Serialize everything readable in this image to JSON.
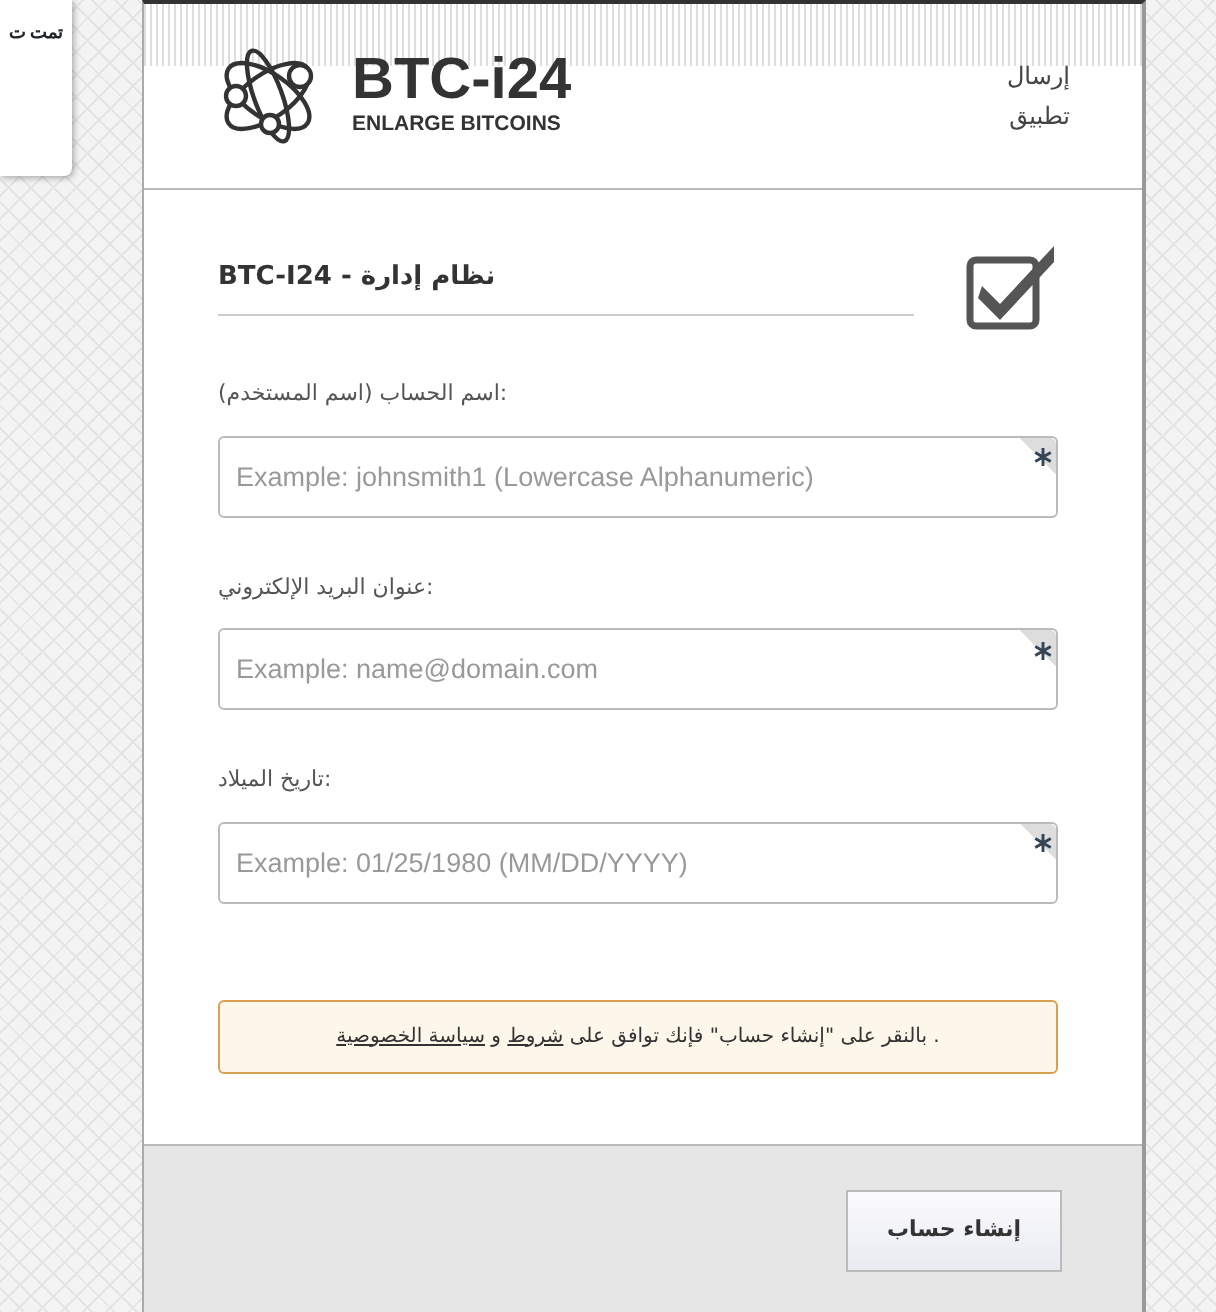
{
  "side_card": {
    "text": "تمت ت"
  },
  "header": {
    "brand": "BTC-i24",
    "tagline": "ENLARGE BITCOINS",
    "links": [
      "إرسال",
      "تطبيق"
    ]
  },
  "form": {
    "title": "BTC-I24 - نظام إدارة",
    "fields": [
      {
        "label": "اسم الحساب (اسم المستخدم):",
        "placeholder": "Example: johnsmith1 (Lowercase Alphanumeric)",
        "required": true
      },
      {
        "label": "عنوان البريد الإلكتروني:",
        "placeholder": "Example: name@domain.com",
        "required": true
      },
      {
        "label": "تاريخ الميلاد:",
        "placeholder": "Example: 01/25/1980 (MM/DD/YYYY)",
        "required": true
      }
    ],
    "notice": [
      {
        "kind": "text",
        "text": ". بالنقر على \"إنشاء حساب\" فإنك توافق على "
      },
      {
        "kind": "link",
        "text": "شروط"
      },
      {
        "kind": "text",
        "text": " و "
      },
      {
        "kind": "link",
        "text": "سياسة الخصوصية"
      }
    ]
  },
  "footer": {
    "button": "إنشاء حساب"
  }
}
